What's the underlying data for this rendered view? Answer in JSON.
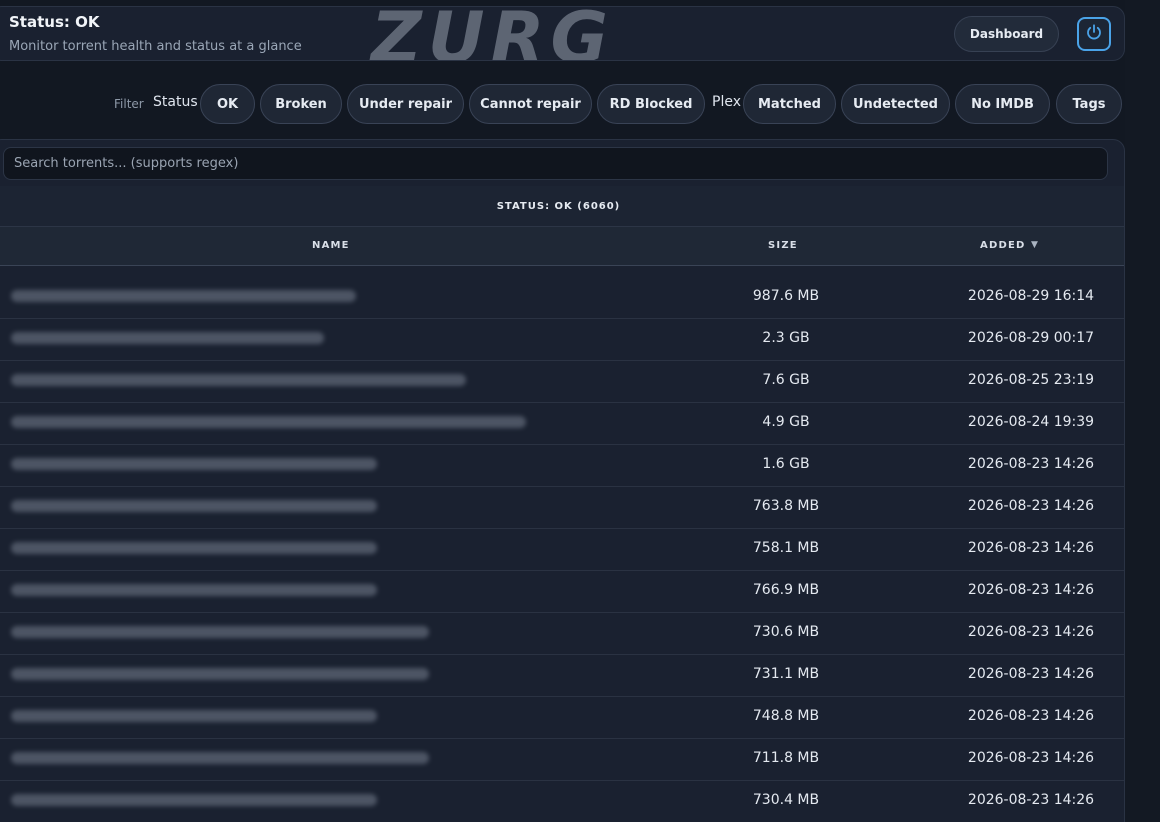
{
  "header": {
    "title": "Status: OK",
    "subtitle": "Monitor torrent health and status at a glance",
    "logo_text": "ZURG",
    "dashboard_label": "Dashboard",
    "power_icon": "power-icon"
  },
  "filter": {
    "label": "Filter",
    "status_group_label": "Status",
    "status_chips": [
      "OK",
      "Broken",
      "Under repair",
      "Cannot repair",
      "RD Blocked"
    ],
    "plex_group_label": "Plex",
    "plex_chips": [
      "Matched",
      "Undetected",
      "No IMDB",
      "Tags"
    ]
  },
  "search": {
    "placeholder": "Search torrents... (supports regex)"
  },
  "table": {
    "section_title": "STATUS: OK (6060)",
    "columns": {
      "name": "NAME",
      "size": "SIZE",
      "added": "ADDED"
    },
    "sort_indicator": "▼",
    "rows": [
      {
        "size": "987.6 MB",
        "added": "2026-08-29 16:14"
      },
      {
        "size": "2.3 GB",
        "added": "2026-08-29 00:17"
      },
      {
        "size": "7.6 GB",
        "added": "2026-08-25 23:19"
      },
      {
        "size": "4.9 GB",
        "added": "2026-08-24 19:39"
      },
      {
        "size": "1.6 GB",
        "added": "2026-08-23 14:26"
      },
      {
        "size": "763.8 MB",
        "added": "2026-08-23 14:26"
      },
      {
        "size": "758.1 MB",
        "added": "2026-08-23 14:26"
      },
      {
        "size": "766.9 MB",
        "added": "2026-08-23 14:26"
      },
      {
        "size": "730.6 MB",
        "added": "2026-08-23 14:26"
      },
      {
        "size": "731.1 MB",
        "added": "2026-08-23 14:26"
      },
      {
        "size": "748.8 MB",
        "added": "2026-08-23 14:26"
      },
      {
        "size": "711.8 MB",
        "added": "2026-08-23 14:26"
      },
      {
        "size": "730.4 MB",
        "added": "2026-08-23 14:26"
      }
    ]
  },
  "colors": {
    "accent": "#4aa3e8",
    "background": "#121822",
    "card": "#1a2130"
  }
}
